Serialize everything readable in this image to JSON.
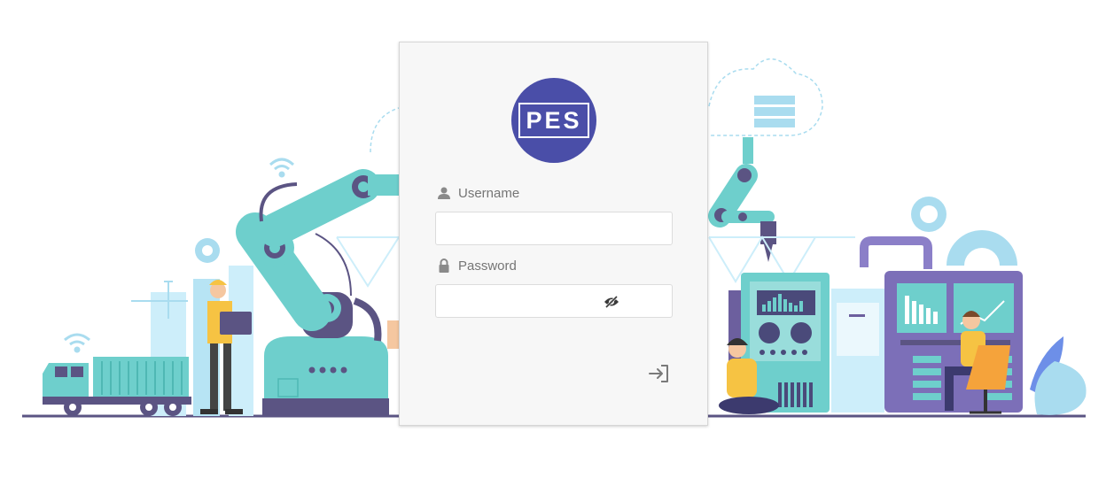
{
  "logo": {
    "text": "PES"
  },
  "form": {
    "username_label": "Username",
    "username_value": "",
    "password_label": "Password",
    "password_value": ""
  },
  "icons": {
    "username": "user-icon",
    "password": "lock-icon",
    "toggle_password": "eye-off-icon",
    "submit": "sign-in-icon"
  },
  "colors": {
    "brand": "#4a4ea8",
    "teal": "#6ecfcc",
    "purple": "#6c5f9e",
    "yellow": "#f6c343",
    "orange": "#f5a33b"
  }
}
